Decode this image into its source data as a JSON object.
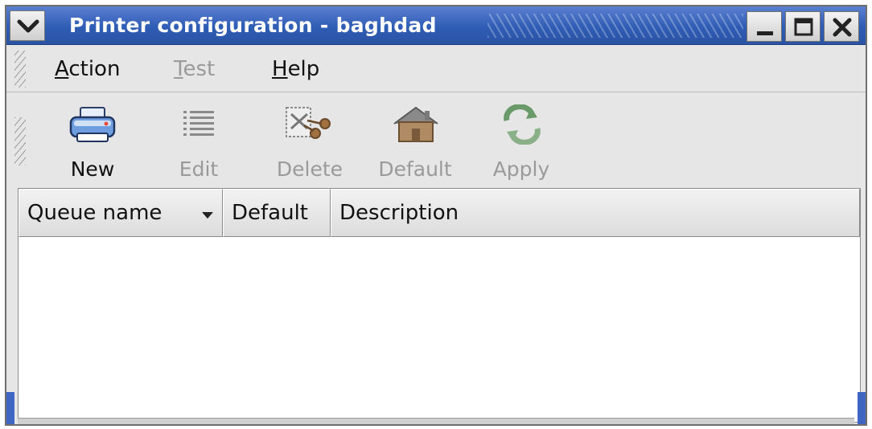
{
  "window": {
    "title": "Printer configuration - baghdad"
  },
  "menubar": {
    "items": [
      {
        "label": "Action",
        "enabled": true
      },
      {
        "label": "Test",
        "enabled": false
      },
      {
        "label": "Help",
        "enabled": true
      }
    ]
  },
  "toolbar": {
    "new_label": "New",
    "edit_label": "Edit",
    "delete_label": "Delete",
    "default_label": "Default",
    "apply_label": "Apply"
  },
  "table": {
    "columns": [
      {
        "label": "Queue name",
        "sorted": "descending"
      },
      {
        "label": "Default"
      },
      {
        "label": "Description"
      }
    ],
    "rows": []
  },
  "colors": {
    "titlebar": "#2f5db5",
    "window_bg": "#e6e6e6",
    "disabled_text": "#9a9a9a"
  }
}
